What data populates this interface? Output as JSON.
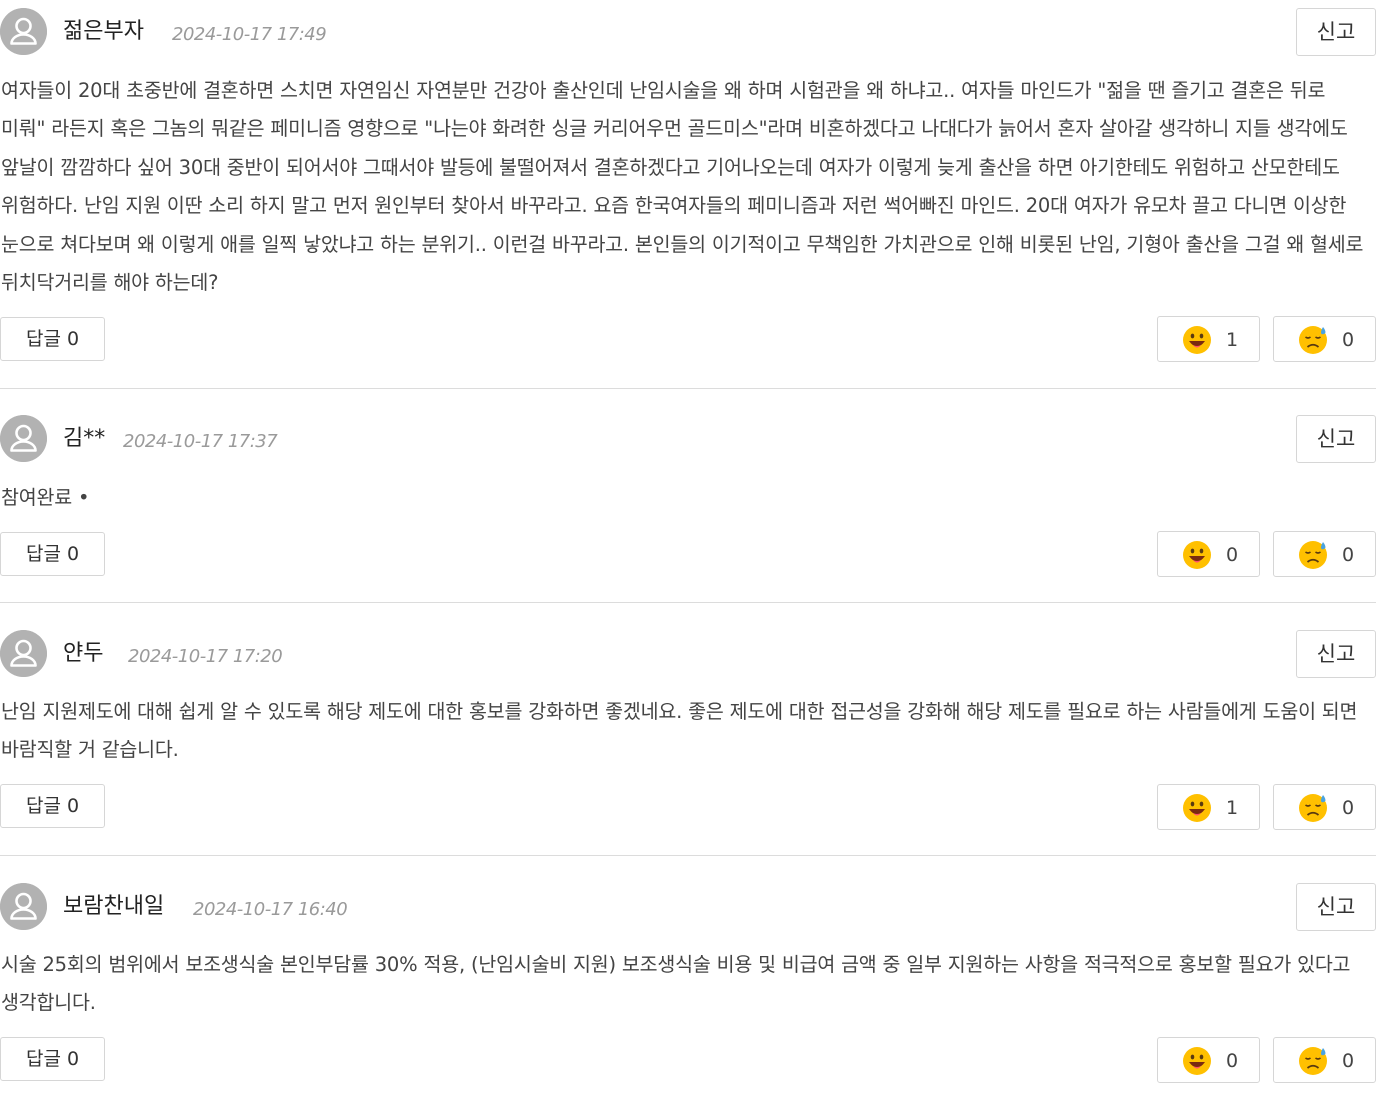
{
  "report_label": "신고",
  "comments": [
    {
      "author": "젊은부자",
      "date": "2024-10-17 17:49",
      "body": "여자들이 20대 초중반에 결혼하면 스치면 자연임신 자연분만 건강아 출산인데 난임시술을 왜 하며 시험관을 왜 하냐고.. 여자들 마인드가 \"젊을 땐 즐기고 결혼은 뒤로 미뤄\" 라든지 혹은 그놈의 뭐같은 페미니즘 영향으로 \"나는야 화려한 싱글 커리어우먼 골드미스\"라며 비혼하겠다고 나대다가 늙어서 혼자 살아갈 생각하니 지들 생각에도 앞날이 깜깜하다 싶어 30대 중반이 되어서야 그때서야 발등에 불떨어져서 결혼하겠다고 기어나오는데 여자가 이렇게 늦게 출산을 하면 아기한테도 위험하고 산모한테도 위험하다. 난임 지원 이딴 소리 하지 말고 먼저 원인부터 찾아서 바꾸라고. 요즘 한국여자들의 페미니즘과 저런 썩어빠진 마인드. 20대 여자가 유모차 끌고 다니면 이상한 눈으로 쳐다보며 왜 이렇게 애를 일찍 낳았냐고 하는 분위기.. 이런걸 바꾸라고. 본인들의 이기적이고 무책임한 가치관으로 인해 비롯된 난임, 기형아 출산을 그걸 왜 혈세로 뒤치닥거리를 해야 하는데?",
      "reply": "답글 0",
      "likes": "1",
      "dislikes": "0"
    },
    {
      "author": "김**",
      "date": "2024-10-17 17:37",
      "body": "참여완료 •",
      "reply": "답글 0",
      "likes": "0",
      "dislikes": "0"
    },
    {
      "author": "얀두",
      "date": "2024-10-17 17:20",
      "body": "난임 지원제도에 대해 쉽게 알 수 있도록 해당 제도에 대한 홍보를 강화하면 좋겠네요. 좋은 제도에 대한 접근성을 강화해 해당 제도를 필요로 하는 사람들에게 도움이 되면 바람직할 거 같습니다.",
      "reply": "답글 0",
      "likes": "1",
      "dislikes": "0"
    },
    {
      "author": "보람찬내일",
      "date": "2024-10-17 16:40",
      "body": "시술 25회의 범위에서 보조생식술 본인부담률 30% 적용, (난임시술비 지원) 보조생식술 비용 및 비급여 금액 중 일부 지원하는 사항을 적극적으로 홍보할 필요가 있다고 생각합니다.",
      "reply": "답글 0",
      "likes": "0",
      "dislikes": "0"
    }
  ],
  "icons": {
    "avatar": "user-avatar-icon",
    "like": "grinning-face-emoji",
    "dislike": "sad-sweat-face-emoji"
  },
  "colors": {
    "avatar_bg": "#b2b2b2",
    "divider": "#dcdcdc",
    "border": "#d6d6d6",
    "emoji_face": "#ffc000"
  }
}
